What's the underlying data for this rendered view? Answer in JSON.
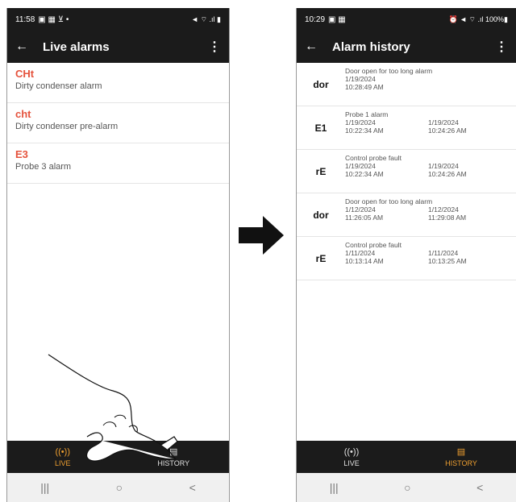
{
  "phone1": {
    "status": {
      "time": "11:58",
      "left_icons": "▣ ▦ ⊻ •",
      "right_icons": "◄ ⌔ .ıl ▮"
    },
    "appbar": {
      "back": "←",
      "title": "Live alarms",
      "menu": "⋮"
    },
    "alarms": [
      {
        "code": "CHt",
        "desc": "Dirty condenser alarm"
      },
      {
        "code": "cht",
        "desc": "Dirty condenser pre-alarm"
      },
      {
        "code": "E3",
        "desc": "Probe 3 alarm"
      }
    ],
    "nav": {
      "live_icon": "((•))",
      "live": "LIVE",
      "history_icon": "▤",
      "history": "HISTORY"
    },
    "sysnav": {
      "recent": "|||",
      "home": "○",
      "back": "<"
    }
  },
  "phone2": {
    "status": {
      "time": "10:29",
      "left_icons": "▣ ▦",
      "right_icons": "⏰ ◄ ⌔ .ıl 100%▮"
    },
    "appbar": {
      "back": "←",
      "title": "Alarm history",
      "menu": "⋮"
    },
    "history": [
      {
        "code": "dor",
        "desc": "Door open for too long alarm",
        "start_date": "1/19/2024",
        "start_time": "10:28:49 AM",
        "end_date": "",
        "end_time": ""
      },
      {
        "code": "E1",
        "desc": "Probe 1 alarm",
        "start_date": "1/19/2024",
        "start_time": "10:22:34 AM",
        "end_date": "1/19/2024",
        "end_time": "10:24:26 AM"
      },
      {
        "code": "rE",
        "desc": "Control probe fault",
        "start_date": "1/19/2024",
        "start_time": "10:22:34 AM",
        "end_date": "1/19/2024",
        "end_time": "10:24:26 AM"
      },
      {
        "code": "dor",
        "desc": "Door open for too long alarm",
        "start_date": "1/12/2024",
        "start_time": "11:26:05 AM",
        "end_date": "1/12/2024",
        "end_time": "11:29:08 AM"
      },
      {
        "code": "rE",
        "desc": "Control probe fault",
        "start_date": "1/11/2024",
        "start_time": "10:13:14 AM",
        "end_date": "1/11/2024",
        "end_time": "10:13:25 AM"
      }
    ],
    "nav": {
      "live_icon": "((•))",
      "live": "LIVE",
      "history_icon": "▤",
      "history": "HISTORY"
    },
    "sysnav": {
      "recent": "|||",
      "home": "○",
      "back": "<"
    }
  },
  "colors": {
    "alarm_code": "#e5533d",
    "active_tab": "#f0a030",
    "bar": "#1b1b1b"
  }
}
